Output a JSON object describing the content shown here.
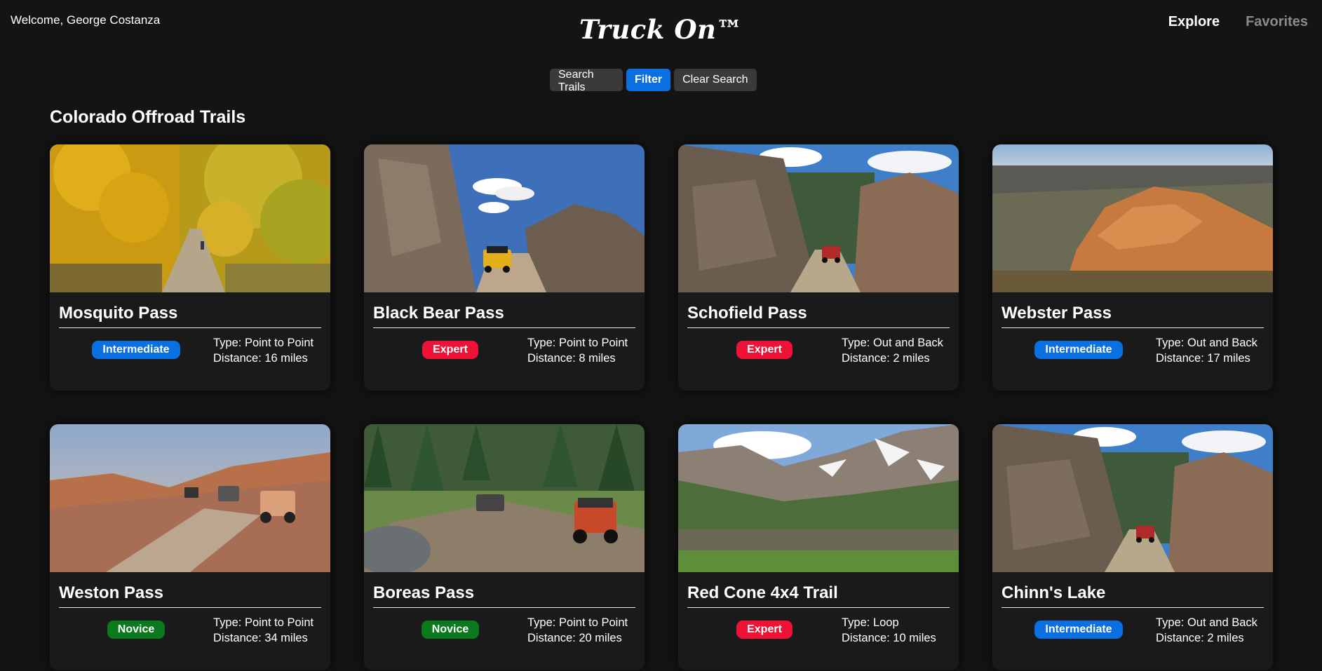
{
  "header": {
    "welcome": "Welcome, George Costanza",
    "brand": "Truck On™",
    "nav": [
      {
        "label": "Explore",
        "active": true
      },
      {
        "label": "Favorites",
        "active": false
      }
    ]
  },
  "search": {
    "input_label": "Search Trails",
    "filter_label": "Filter",
    "clear_label": "Clear Search"
  },
  "section_title": "Colorado Offroad Trails",
  "colors": {
    "intermediate": "#0a6fe0",
    "expert": "#f01236",
    "novice": "#0b7a1e",
    "background": "#141414"
  },
  "trails": [
    {
      "name": "Mosquito Pass",
      "difficulty": "Intermediate",
      "type": "Type: Point to Point",
      "distance": "Distance: 16 miles",
      "scene": "aspen"
    },
    {
      "name": "Black Bear Pass",
      "difficulty": "Expert",
      "type": "Type: Point to Point",
      "distance": "Distance: 8 miles",
      "scene": "rocks"
    },
    {
      "name": "Schofield Pass",
      "difficulty": "Expert",
      "type": "Type: Out and Back",
      "distance": "Distance: 2 miles",
      "scene": "canyon"
    },
    {
      "name": "Webster Pass",
      "difficulty": "Intermediate",
      "type": "Type: Out and Back",
      "distance": "Distance: 17 miles",
      "scene": "redrock"
    },
    {
      "name": "Weston Pass",
      "difficulty": "Novice",
      "type": "Type: Point to Point",
      "distance": "Distance: 34 miles",
      "scene": "ridge"
    },
    {
      "name": "Boreas Pass",
      "difficulty": "Novice",
      "type": "Type: Point to Point",
      "distance": "Distance: 20 miles",
      "scene": "forest"
    },
    {
      "name": "Red Cone 4x4 Trail",
      "difficulty": "Expert",
      "type": "Type: Loop",
      "distance": "Distance: 10 miles",
      "scene": "lake"
    },
    {
      "name": "Chinn's Lake",
      "difficulty": "Intermediate",
      "type": "Type: Out and Back",
      "distance": "Distance: 2 miles",
      "scene": "canyon"
    }
  ]
}
